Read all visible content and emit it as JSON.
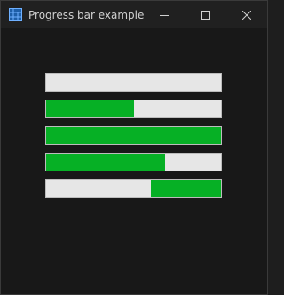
{
  "window": {
    "title": "Progress bar example",
    "icon": "app-grid-icon",
    "controls": [
      "minimize-icon",
      "maximize-icon",
      "close-icon"
    ]
  },
  "colors": {
    "fill": "#06b025",
    "track": "#e6e6e6",
    "background": "#181818"
  },
  "progress_bars": [
    {
      "name": "progress-bar-1",
      "value_percent": 0,
      "fill_from": "left"
    },
    {
      "name": "progress-bar-2",
      "value_percent": 50,
      "fill_from": "left"
    },
    {
      "name": "progress-bar-3",
      "value_percent": 100,
      "fill_from": "left"
    },
    {
      "name": "progress-bar-4",
      "value_percent": 68,
      "fill_from": "left"
    },
    {
      "name": "progress-bar-5",
      "value_percent": 40,
      "fill_from": "right"
    }
  ]
}
